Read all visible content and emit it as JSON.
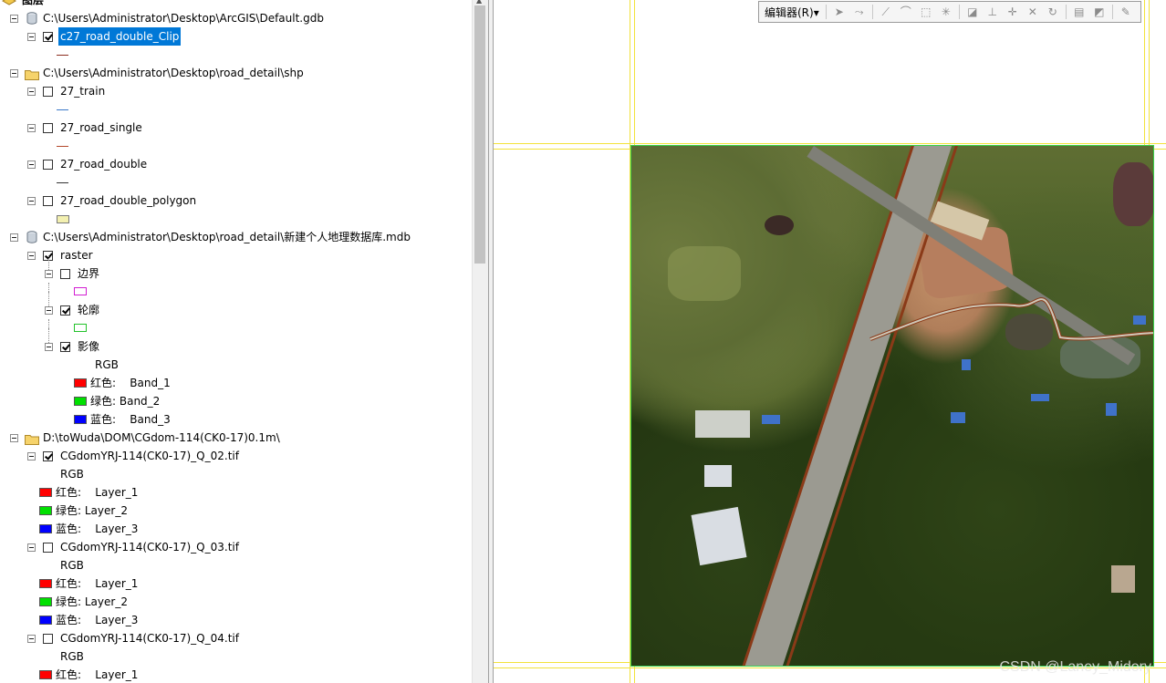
{
  "toc": {
    "header_label": "图层",
    "entries": [
      {
        "kind": "workspace",
        "icon": "database-icon",
        "label": "C:\\Users\\Administrator\\Desktop\\ArcGIS\\Default.gdb"
      },
      {
        "kind": "layer",
        "checked": true,
        "selected": true,
        "label": "c27_road_double_Clip",
        "symbol": {
          "type": "line",
          "color": "#8b2d1f"
        }
      },
      {
        "kind": "workspace",
        "icon": "folder-icon",
        "label": "C:\\Users\\Administrator\\Desktop\\road_detail\\shp"
      },
      {
        "kind": "layer",
        "checked": false,
        "label": "27_train",
        "symbol": {
          "type": "line",
          "color": "#3a78c8"
        }
      },
      {
        "kind": "layer",
        "checked": false,
        "label": "27_road_single",
        "symbol": {
          "type": "line",
          "color": "#b3472a"
        }
      },
      {
        "kind": "layer",
        "checked": false,
        "label": "27_road_double",
        "symbol": {
          "type": "line",
          "color": "#333333"
        }
      },
      {
        "kind": "layer",
        "checked": false,
        "label": "27_road_double_polygon",
        "symbol": {
          "type": "fill",
          "color": "#f3f0b0"
        }
      },
      {
        "kind": "workspace",
        "icon": "database-icon",
        "label": "C:\\Users\\Administrator\\Desktop\\road_detail\\新建个人地理数据库.mdb"
      },
      {
        "kind": "group",
        "checked": true,
        "label": "raster"
      },
      {
        "kind": "sublayer",
        "checked": false,
        "label": "边界",
        "symbol": {
          "type": "outline",
          "color": "#d21ed2"
        }
      },
      {
        "kind": "sublayer",
        "checked": true,
        "label": "轮廓",
        "symbol": {
          "type": "outline",
          "color": "#22c22a"
        }
      },
      {
        "kind": "sublayer",
        "checked": true,
        "label": "影像",
        "bands_header": "RGB",
        "bands": [
          {
            "label": "红色:    Band_1",
            "color": "#ff0000"
          },
          {
            "label": "绿色: Band_2",
            "color": "#00e000"
          },
          {
            "label": "蓝色:    Band_3",
            "color": "#0000ff"
          }
        ]
      },
      {
        "kind": "workspace",
        "icon": "folder-icon",
        "label": "D:\\toWuda\\DOM\\CGdom-114(CK0-17)0.1m\\"
      },
      {
        "kind": "raster",
        "checked": true,
        "label": "CGdomYRJ-114(CK0-17)_Q_02.tif",
        "bands_header": "RGB",
        "bands": [
          {
            "label": "红色:    Layer_1",
            "color": "#ff0000"
          },
          {
            "label": "绿色: Layer_2",
            "color": "#00e000"
          },
          {
            "label": "蓝色:    Layer_3",
            "color": "#0000ff"
          }
        ]
      },
      {
        "kind": "raster",
        "checked": false,
        "label": "CGdomYRJ-114(CK0-17)_Q_03.tif",
        "bands_header": "RGB",
        "bands": [
          {
            "label": "红色:    Layer_1",
            "color": "#ff0000"
          },
          {
            "label": "绿色: Layer_2",
            "color": "#00e000"
          },
          {
            "label": "蓝色:    Layer_3",
            "color": "#0000ff"
          }
        ]
      },
      {
        "kind": "raster",
        "checked": false,
        "label": "CGdomYRJ-114(CK0-17)_Q_04.tif",
        "bands_header": "RGB",
        "bands": [
          {
            "label": "红色:    Layer_1",
            "color": "#ff0000"
          }
        ]
      }
    ]
  },
  "toolbar": {
    "editor_label": "编辑器(R)▾",
    "tool_icons": [
      "edit-tool-icon",
      "edit-annotation-icon",
      "straight-segment-icon",
      "arc-segment-icon",
      "trace-icon",
      "point-icon",
      "edit-vertices-icon",
      "reshape-icon",
      "cut-polygons-icon",
      "split-icon",
      "rotate-icon",
      "attributes-icon",
      "sketch-properties-icon",
      "editor-toolbar-options-icon"
    ]
  },
  "map": {
    "frame_color": "#f2e23a",
    "image_outline_color": "#39d24a",
    "watermark": "CSDN @Laney_Midory"
  }
}
